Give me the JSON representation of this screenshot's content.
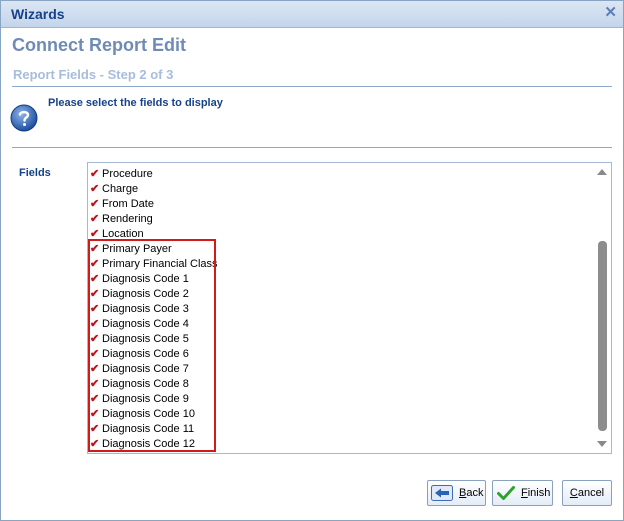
{
  "window": {
    "title": "Wizards",
    "close_glyph": "✕"
  },
  "header": {
    "title": "Connect Report Edit",
    "step": "Report Fields - Step 2 of 3"
  },
  "instruction": "Please select the fields to display",
  "fields": {
    "label": "Fields",
    "items": [
      "Procedure",
      "Charge",
      "From Date",
      "Rendering",
      "Location",
      "Primary Payer",
      "Primary Financial Class",
      "Diagnosis Code 1",
      "Diagnosis Code 2",
      "Diagnosis Code 3",
      "Diagnosis Code 4",
      "Diagnosis Code 5",
      "Diagnosis Code 6",
      "Diagnosis Code 7",
      "Diagnosis Code 8",
      "Diagnosis Code 9",
      "Diagnosis Code 10",
      "Diagnosis Code 11",
      "Diagnosis Code 12"
    ],
    "check_glyph": "✔",
    "check_color": "#c0121a",
    "highlight_color": "#d11a1a"
  },
  "buttons": {
    "back": {
      "accesskey": "B",
      "rest": "ack"
    },
    "finish": {
      "accesskey": "F",
      "rest": "inish"
    },
    "cancel": {
      "accesskey": "C",
      "rest": "ancel"
    }
  },
  "icons": {
    "help": "help-question-icon",
    "back": "back-arrow-icon",
    "finish": "green-checkmark-icon",
    "close": "close-icon"
  }
}
